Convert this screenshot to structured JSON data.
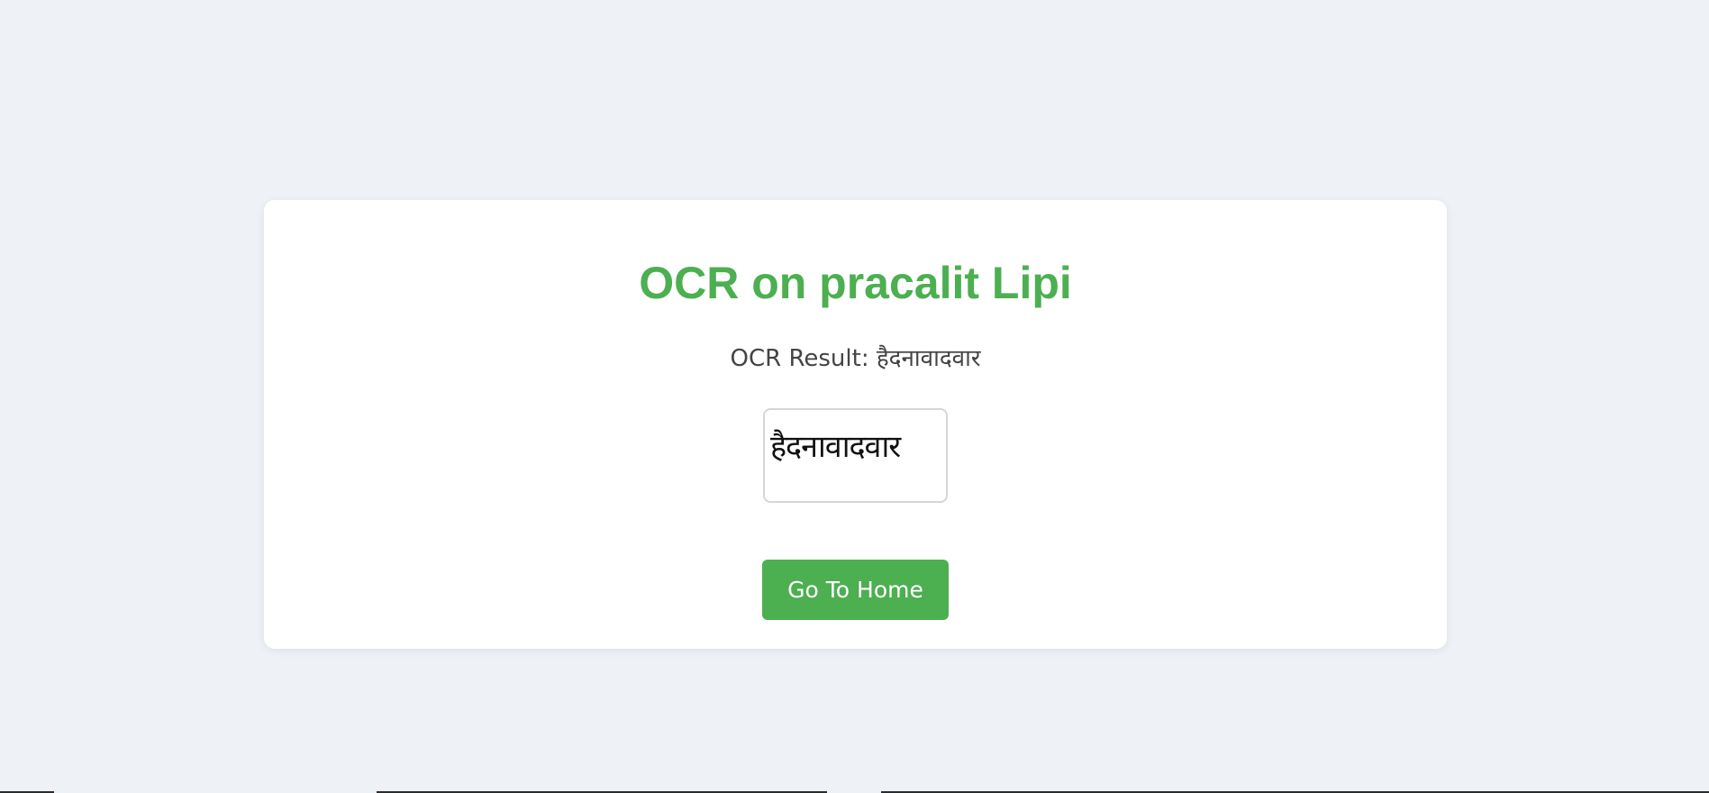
{
  "page": {
    "title": "OCR on pracalit Lipi",
    "result_label": "OCR Result: हैदनावादवार",
    "image_text": "हैदनावादवार",
    "button_label": "Go To Home"
  },
  "colors": {
    "background": "#eef1f6",
    "accent": "#4caf50",
    "card": "#ffffff",
    "text": "#444444"
  }
}
